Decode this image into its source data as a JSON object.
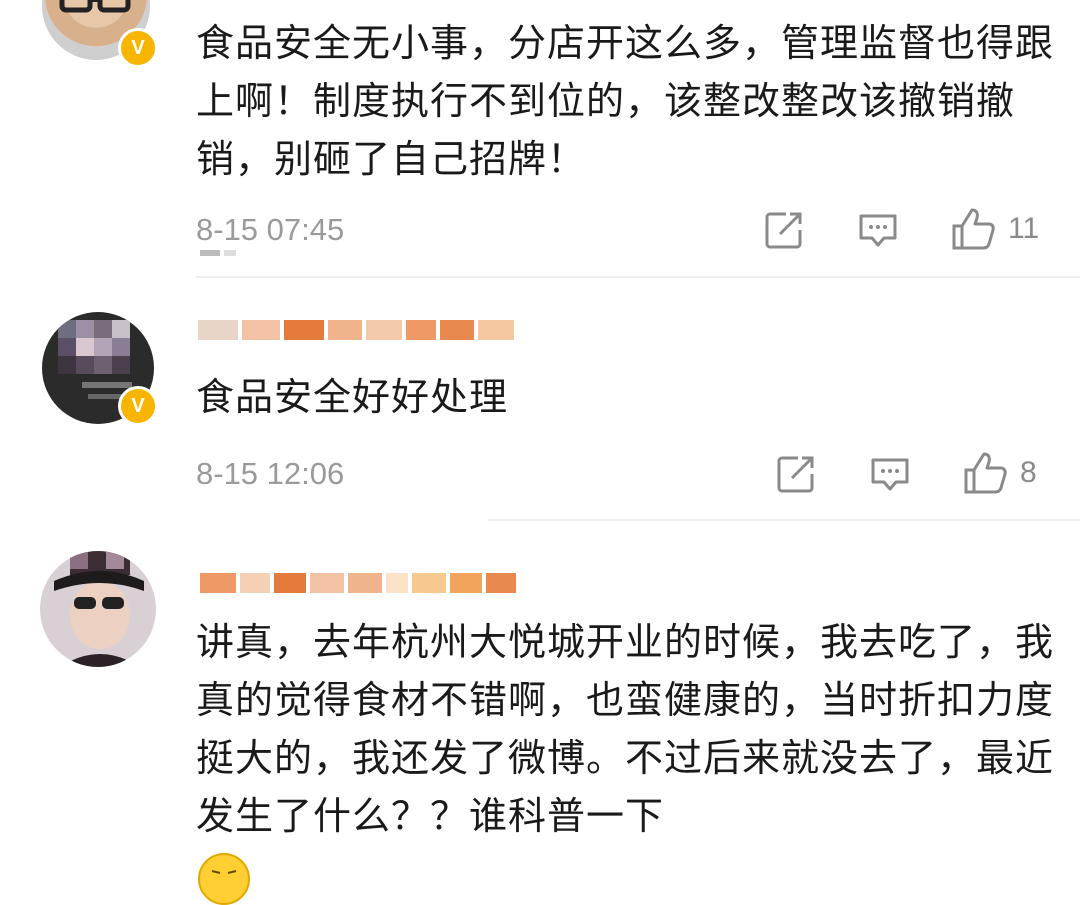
{
  "comments": [
    {
      "verified_badge": "V",
      "text": "食品安全无小事，分店开这么多，管理监督也得跟上啊！制度执行不到位的，该整改整改该撤销撤销，别砸了自己招牌！",
      "time": "8-15 07:45",
      "like_count": "11",
      "icons": [
        "repost-icon",
        "comment-icon",
        "like-icon"
      ]
    },
    {
      "verified_badge": "V",
      "text": "食品安全好好处理",
      "time": "8-15 12:06",
      "like_count": "8",
      "icons": [
        "repost-icon",
        "comment-icon",
        "like-icon"
      ]
    },
    {
      "text": "讲真，去年杭州大悦城开业的时候，我去吃了，我真的觉得食材不错啊，也蛮健康的，当时折扣力度挺大的，我还发了微博。不过后来就没去了，最近发生了什么？？谁科普一下",
      "trailing_icon": "grimace-emoji-icon"
    }
  ],
  "colors": {
    "text": "#1a1a1a",
    "meta": "#9a9a9a",
    "verified": "#f7b500",
    "divider": "#eeeeee"
  }
}
